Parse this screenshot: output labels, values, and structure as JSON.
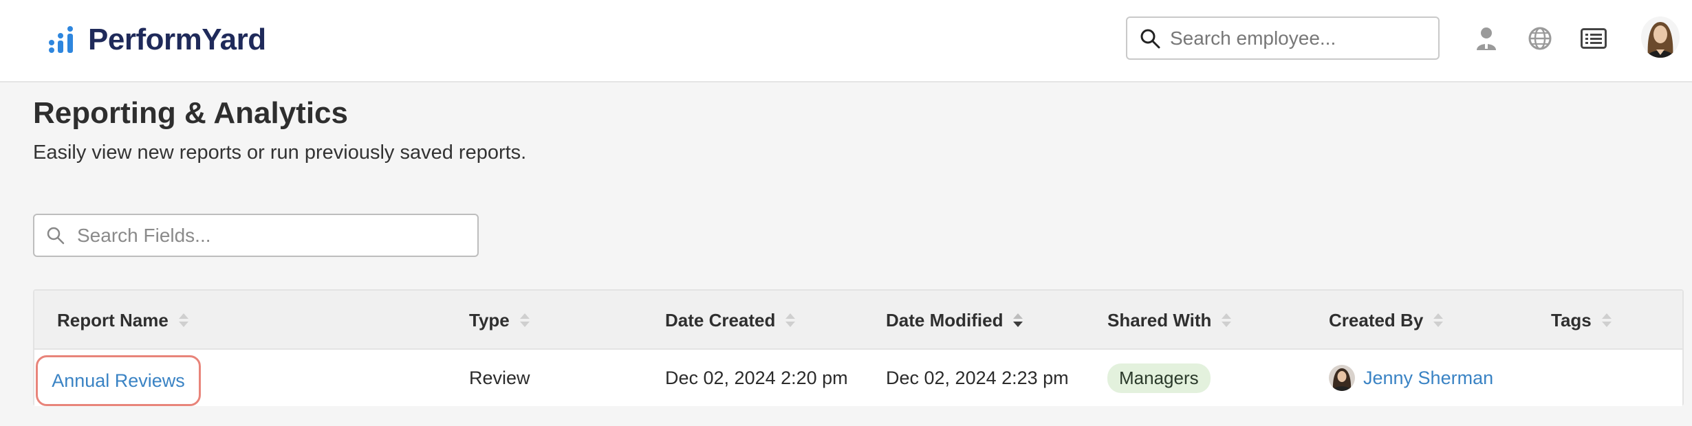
{
  "app": {
    "brand": "PerformYard",
    "brand_color": "#1f2a5a",
    "brand_icon_color": "#2e86de"
  },
  "header": {
    "search_placeholder": "Search employee...",
    "search_icon": "search-icon",
    "icons": [
      "person-icon",
      "globe-icon",
      "list-icon"
    ],
    "avatar": "user-avatar"
  },
  "page": {
    "title": "Reporting & Analytics",
    "subtitle": "Easily view new reports or run previously saved reports."
  },
  "field_search": {
    "placeholder": "Search Fields..."
  },
  "table": {
    "columns": [
      {
        "label": "Report Name",
        "sort": "none"
      },
      {
        "label": "Type",
        "sort": "none"
      },
      {
        "label": "Date Created",
        "sort": "none"
      },
      {
        "label": "Date Modified",
        "sort": "active"
      },
      {
        "label": "Shared With",
        "sort": "none"
      },
      {
        "label": "Created By",
        "sort": "none"
      },
      {
        "label": "Tags",
        "sort": "none"
      }
    ],
    "rows": [
      {
        "report_name": "Annual Reviews",
        "type": "Review",
        "date_created": "Dec 02, 2024 2:20 pm",
        "date_modified": "Dec 02, 2024 2:23 pm",
        "shared_with": "Managers",
        "created_by": "Jenny Sherman",
        "tags": ""
      }
    ]
  },
  "colors": {
    "link": "#3a83c4",
    "highlight": "#e8847a",
    "badge_bg": "#e3f1dd"
  }
}
